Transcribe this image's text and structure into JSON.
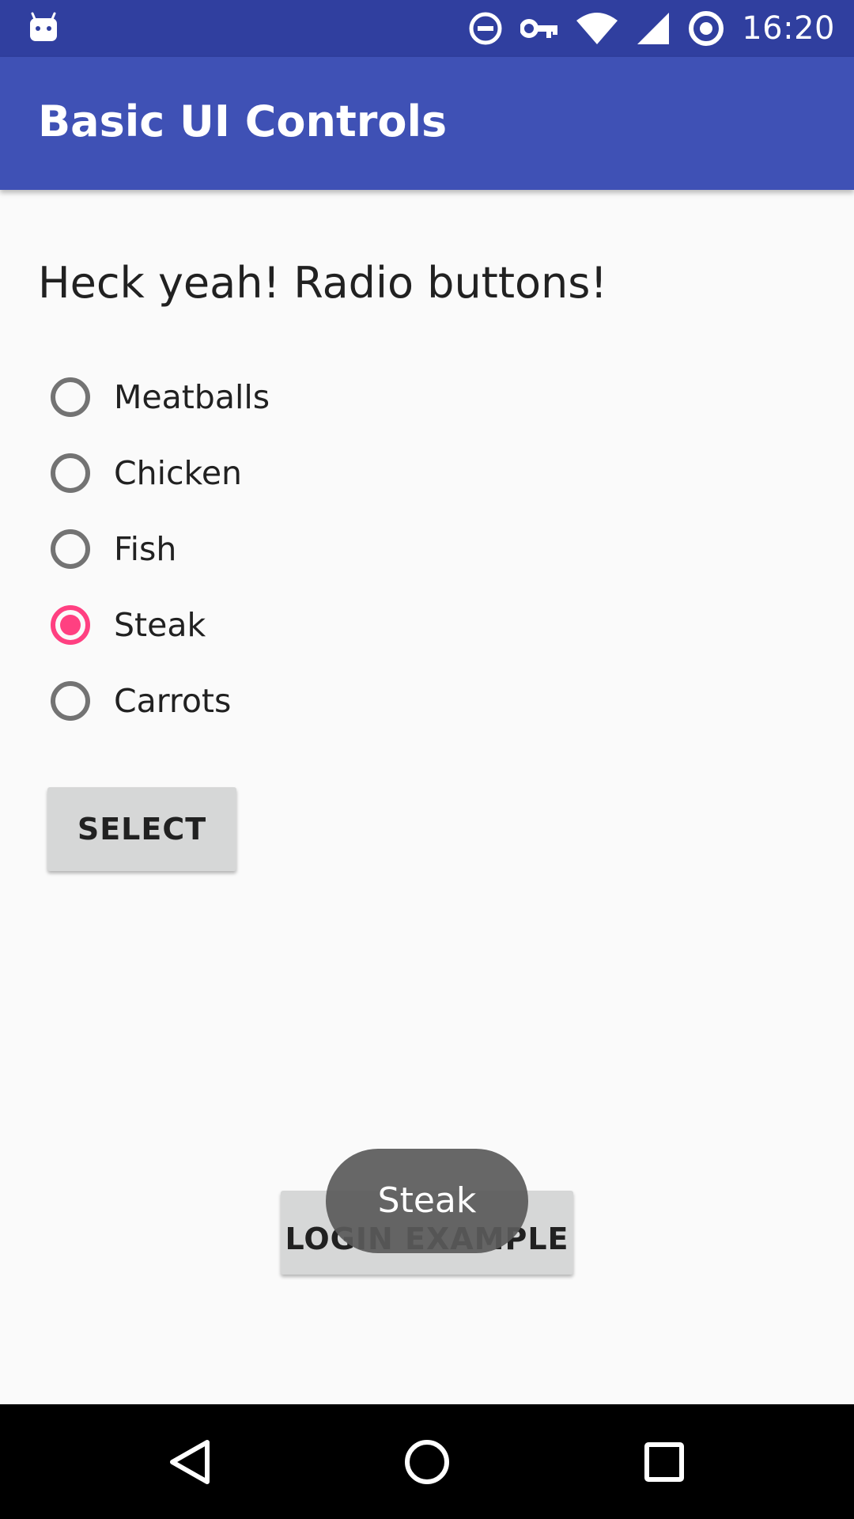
{
  "status_bar": {
    "time": "16:20",
    "icons": [
      "android-notification-icon",
      "do-not-disturb-icon",
      "vpn-key-icon",
      "wifi-icon",
      "cell-signal-icon",
      "sync-icon"
    ]
  },
  "app_bar": {
    "title": "Basic UI Controls",
    "color": "#3f51b5",
    "status_color": "#303f9f"
  },
  "main": {
    "heading": "Heck yeah! Radio buttons!",
    "radio_options": [
      {
        "label": "Meatballs",
        "checked": false
      },
      {
        "label": "Chicken",
        "checked": false
      },
      {
        "label": "Fish",
        "checked": false
      },
      {
        "label": "Steak",
        "checked": true
      },
      {
        "label": "Carrots",
        "checked": false
      }
    ],
    "accent_color": "#ff4081",
    "select_button_label": "SELECT",
    "login_button_label": "LOGIN EXAMPLE"
  },
  "toast": {
    "message": "Steak"
  },
  "nav_bar": {
    "icons": [
      "back-icon",
      "home-icon",
      "recents-icon"
    ]
  }
}
